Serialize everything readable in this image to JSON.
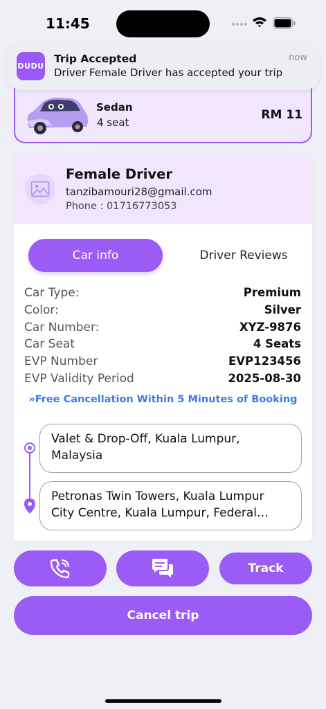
{
  "status_bar": {
    "time": "11:45"
  },
  "notification": {
    "logo_text": "DUDU",
    "title": "Trip Accepted",
    "body": "Driver Female Driver has accepted your trip",
    "time": "now"
  },
  "car": {
    "name": "Sedan",
    "seats": "4 seat",
    "price": "RM 11"
  },
  "driver": {
    "name": "Female Driver",
    "email": "tanzibamouri28@gmail.com",
    "phone": "Phone : 01716773053"
  },
  "tabs": [
    {
      "label": "Car info",
      "active": true
    },
    {
      "label": "Driver Reviews",
      "active": false
    }
  ],
  "car_info": [
    {
      "label": "Car Type:",
      "value": "Premium"
    },
    {
      "label": "Color:",
      "value": "Silver"
    },
    {
      "label": "Car Number:",
      "value": "XYZ-9876"
    },
    {
      "label": "Car Seat",
      "value": "4 Seats"
    },
    {
      "label": "EVP Number",
      "value": "EVP123456"
    },
    {
      "label": "EVP Validity Period",
      "value": "2025-08-30"
    }
  ],
  "cancel_note": "»Free Cancellation Within 5 Minutes of Booking",
  "route": {
    "pickup": "Valet & Drop-Off,  Kuala Lumpur, Malaysia",
    "dropoff": "Petronas Twin Towers, Kuala Lumpur City Centre, Kuala Lumpur, Federal Territory of Kuala Lumpur, Malaysia"
  },
  "actions": {
    "call_icon": "phone-icon",
    "chat_icon": "chat-icon",
    "track_label": "Track",
    "cancel_label": "Cancel trip"
  },
  "colors": {
    "accent": "#9b5cf6",
    "accent_light": "#f1e6fd",
    "link_blue": "#3a7ae6",
    "background": "#eef0f6"
  }
}
